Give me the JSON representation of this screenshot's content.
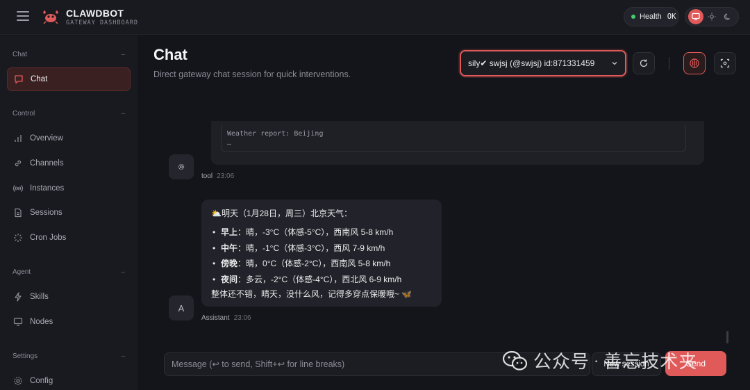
{
  "colors": {
    "accent": "#e05a5a",
    "health_ok": "#3fcf6a",
    "background": "#14151a",
    "surface": "#191a20"
  },
  "header": {
    "brand_title": "CLAWDBOT",
    "brand_subtitle": "GATEWAY DASHBOARD",
    "health_label": "Health",
    "health_value": "OK",
    "theme_options": [
      "monitor-icon",
      "sun-icon",
      "moon-icon"
    ],
    "active_theme": "monitor-icon"
  },
  "sidebar": {
    "sections": [
      {
        "title": "Chat",
        "items": [
          {
            "label": "Chat",
            "icon": "chat-bubble-icon",
            "active": true
          }
        ]
      },
      {
        "title": "Control",
        "items": [
          {
            "label": "Overview",
            "icon": "bar-chart-icon"
          },
          {
            "label": "Channels",
            "icon": "link-icon"
          },
          {
            "label": "Instances",
            "icon": "radio-broadcast-icon"
          },
          {
            "label": "Sessions",
            "icon": "document-icon"
          },
          {
            "label": "Cron Jobs",
            "icon": "loader-icon"
          }
        ]
      },
      {
        "title": "Agent",
        "items": [
          {
            "label": "Skills",
            "icon": "lightning-icon"
          },
          {
            "label": "Nodes",
            "icon": "monitor-icon"
          }
        ]
      },
      {
        "title": "Settings",
        "items": [
          {
            "label": "Config",
            "icon": "gear-icon"
          }
        ]
      }
    ]
  },
  "main": {
    "title": "Chat",
    "subtitle": "Direct gateway chat session for quick interventions.",
    "session_select_value": "sily✔ swjsj (@swjsj) id:871331459"
  },
  "messages": {
    "tool_output": "Weather report: Beijing",
    "tool_output_more": "–",
    "tool_avatar_icon": "gear-icon",
    "tool_sender": "tool",
    "tool_time": "23:06",
    "assistant_avatar": "A",
    "assistant_sender": "Assistant",
    "assistant_time": "23:06",
    "assistant_intro": "⛅明天（1月28日，周三）北京天气：",
    "forecast": [
      {
        "period": "早上",
        "detail": "：晴，-3°C（体感-5°C），西南风 5-8 km/h"
      },
      {
        "period": "中午",
        "detail": "：晴，-1°C（体感-3°C），西风 7-9 km/h"
      },
      {
        "period": "傍晚",
        "detail": "：晴，0°C（体感-2°C），西南风 5-8 km/h"
      },
      {
        "period": "夜间",
        "detail": "：多云，-2°C（体感-4°C），西北风 6-9 km/h"
      }
    ],
    "assistant_summary": "整体还不错，晴天，没什么风，记得多穿点保暖哦~ 🦋"
  },
  "composer": {
    "placeholder": "Message (↩ to send, Shift+↩ for line breaks)",
    "new_session_label": "New session",
    "send_label": "Send"
  },
  "watermark": {
    "text": "公众号",
    "separator": "·",
    "name": "善忘技术夹"
  }
}
